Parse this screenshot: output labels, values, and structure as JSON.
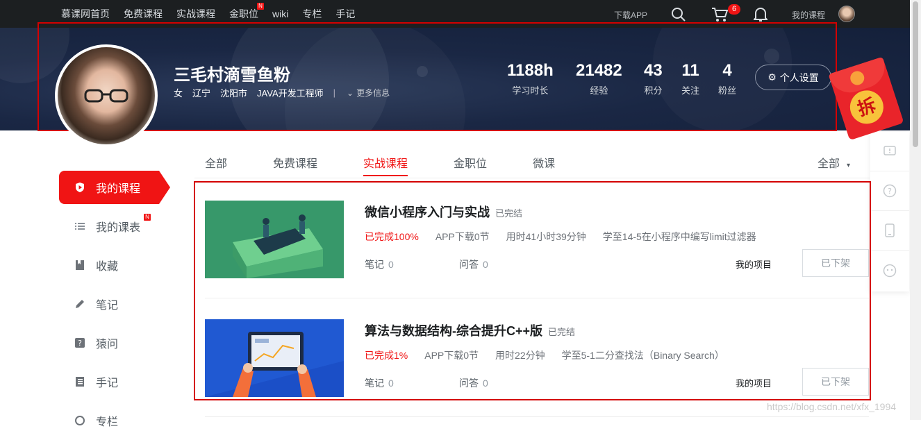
{
  "topnav": {
    "links": [
      "慕课网首页",
      "免费课程",
      "实战课程",
      "金职位",
      "wiki",
      "专栏",
      "手记"
    ],
    "new_badge": "N",
    "download_app": "下载APP",
    "cart_count": "6",
    "my_course": "我的课程"
  },
  "profile": {
    "name": "三毛村滴雪鱼粉",
    "gender": "女",
    "province": "辽宁",
    "city": "沈阳市",
    "job": "JAVA开发工程师",
    "more": "更多信息",
    "settings": "个人设置",
    "stats": [
      {
        "num": "1188h",
        "label": "学习时长"
      },
      {
        "num": "21482",
        "label": "经验"
      },
      {
        "num": "43",
        "label": "积分"
      },
      {
        "num": "11",
        "label": "关注"
      },
      {
        "num": "4",
        "label": "粉丝"
      }
    ]
  },
  "red_packet": {
    "label": "拆"
  },
  "sidebar": {
    "items": [
      {
        "label": "我的课程",
        "icon": "shield-play-icon"
      },
      {
        "label": "我的课表",
        "icon": "list-icon"
      },
      {
        "label": "收藏",
        "icon": "bookmark-icon"
      },
      {
        "label": "笔记",
        "icon": "pen-icon"
      },
      {
        "label": "猿问",
        "icon": "question-icon"
      },
      {
        "label": "手记",
        "icon": "notebook-icon"
      },
      {
        "label": "专栏",
        "icon": "column-icon"
      }
    ],
    "new_badge": "N"
  },
  "tabs": [
    "全部",
    "免费课程",
    "实战课程",
    "金职位",
    "微课"
  ],
  "filter": "全部",
  "courses": [
    {
      "title": "微信小程序入门与实战",
      "status": "已完结",
      "progress": "已完成100%",
      "app_download": "APP下载0节",
      "time_spent": "用时41小时39分钟",
      "learned_to": "学至14-5在小程序中编写limit过滤器",
      "notes_label": "笔记",
      "notes_count": "0",
      "qa_label": "问答",
      "qa_count": "0",
      "project": "我的项目",
      "off_shelf": "已下架"
    },
    {
      "title": "算法与数据结构-综合提升C++版",
      "status": "已完结",
      "progress": "已完成1%",
      "app_download": "APP下载0节",
      "time_spent": "用时22分钟",
      "learned_to": "学至5-1二分查找法（Binary Search）",
      "notes_label": "笔记",
      "notes_count": "0",
      "qa_label": "问答",
      "qa_count": "0",
      "project": "我的项目",
      "off_shelf": "已下架"
    }
  ],
  "watermark": "https://blog.csdn.net/xfx_1994",
  "colors": {
    "accent": "#f01414",
    "hero": "#1a2744",
    "nav": "#1c1f21"
  }
}
